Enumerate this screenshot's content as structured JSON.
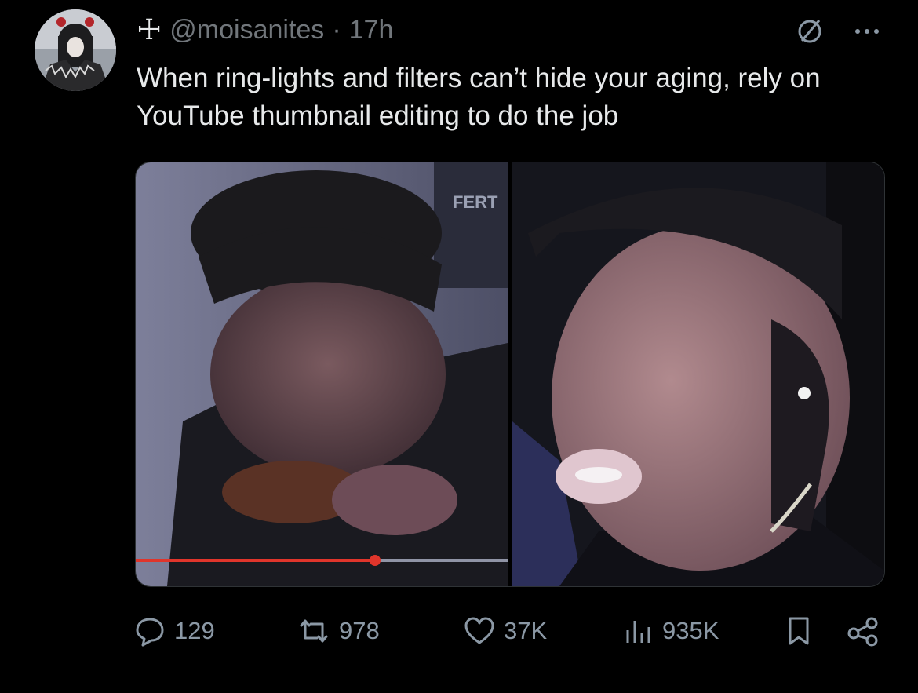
{
  "author": {
    "symbol": "☩",
    "handle": "@moisanites",
    "separator": "·",
    "time": "17h"
  },
  "tweet": {
    "text": "When ring-lights and filters can’t hide your aging, rely on YouTube thumbnail editing to do the job"
  },
  "media": {
    "left_overlay_text": "FERT"
  },
  "icons": {
    "grok": "no-entry-icon",
    "more": "more-icon",
    "reply": "reply-icon",
    "retweet": "retweet-icon",
    "like": "heart-icon",
    "views": "views-icon",
    "bookmark": "bookmark-icon",
    "share": "share-icon"
  },
  "metrics": {
    "replies": "129",
    "retweets": "978",
    "likes": "37K",
    "views": "935K"
  },
  "colors": {
    "background": "#000000",
    "text": "#e7e9ea",
    "muted": "#71767b",
    "progress": "#e0352b"
  }
}
